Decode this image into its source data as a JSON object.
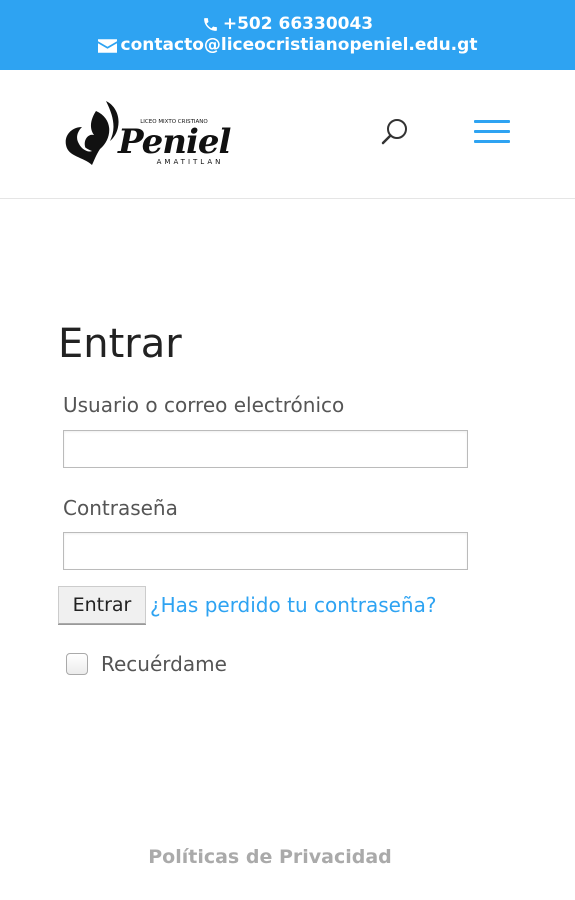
{
  "topbar": {
    "phone": "+502 66330043",
    "email": "contacto@liceocristianopeniel.edu.gt",
    "icons": [
      "phone-icon",
      "envelope-icon"
    ]
  },
  "header": {
    "logo": {
      "script_text": "Peniel",
      "small_text": "LICEO MIXTO CRISTIANO",
      "city_text": "AMATITLAN"
    },
    "icons": [
      "search-icon",
      "menu-icon"
    ]
  },
  "login": {
    "title": "Entrar",
    "username_label": "Usuario o correo electrónico",
    "username_value": "",
    "password_label": "Contraseña",
    "password_value": "",
    "submit_label": "Entrar",
    "lost_password_label": "¿Has perdido tu contraseña?",
    "remember_label": "Recuérdame",
    "remember_checked": false
  },
  "footer": {
    "privacy_label": "Políticas de Privacidad"
  },
  "colors": {
    "accent": "#2ea3f2",
    "footer_text": "#aaaaaa"
  }
}
